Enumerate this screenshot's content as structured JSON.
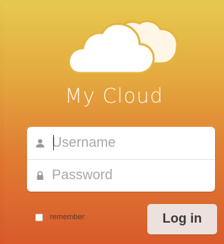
{
  "app": {
    "title": "My Cloud",
    "logo_icon": "cloud-icon"
  },
  "login_form": {
    "username": {
      "placeholder": "Username",
      "value": "",
      "icon": "user-icon"
    },
    "password": {
      "placeholder": "Password",
      "value": "",
      "icon": "lock-icon"
    },
    "remember": {
      "label": "remember",
      "checked": false
    },
    "submit_label": "Log in"
  },
  "colors": {
    "background_top": "#e6c84e",
    "background_bottom": "#d95a2b",
    "title_color": "#fff8ea",
    "button_bg": "#ede1dd"
  }
}
